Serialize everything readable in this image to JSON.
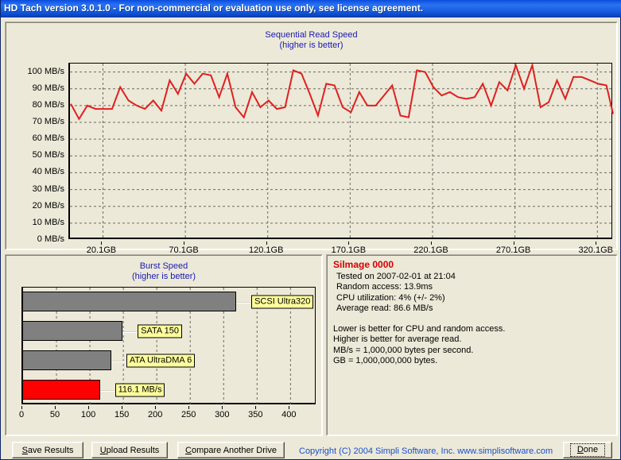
{
  "window": {
    "title": "HD Tach version 3.0.1.0  - For non-commercial or evaluation use only, see license agreement.",
    "titlebar_color": "#0a4ad8"
  },
  "sequential": {
    "title": "Sequential Read Speed",
    "subtitle": "(higher is better)"
  },
  "burst": {
    "title": "Burst Speed",
    "subtitle": "(higher is better)"
  },
  "info": {
    "drive": "Silmage 0000",
    "tested": "Tested on 2007-02-01 at 21:04",
    "random_access": "Random access: 13.9ms",
    "cpu_utilization": "CPU utilization: 4% (+/- 2%)",
    "average_read": "Average read: 86.6 MB/s",
    "note1": "Lower is better for CPU and random access.",
    "note2": "Higher is better for average read.",
    "note3": "MB/s = 1,000,000 bytes per second.",
    "note4": "GB = 1,000,000,000 bytes."
  },
  "buttons": {
    "save": "Save Results",
    "save_accel": "S",
    "save_rest": "ave Results",
    "upload": "Upload Results",
    "upload_accel": "U",
    "upload_rest": "pload Results",
    "compare": "Compare Another Drive",
    "compare_accel": "C",
    "compare_rest": "ompare Another Drive",
    "done": "Done",
    "done_accel": "D",
    "done_rest": "one",
    "copyright": "Copyright (C) 2004 Simpli Software, Inc. www.simplisoftware.com"
  },
  "chart_data": [
    {
      "type": "line",
      "title": "Sequential Read Speed",
      "subtitle": "(higher is better)",
      "xlabel": "",
      "ylabel": "MB/s",
      "xlim": [
        0.1,
        330.1
      ],
      "ylim": [
        0,
        105
      ],
      "grid": true,
      "line_color": "#e02020",
      "ytick_labels": [
        "100 MB/s",
        "90 MB/s",
        "80 MB/s",
        "70 MB/s",
        "60 MB/s",
        "50 MB/s",
        "40 MB/s",
        "30 MB/s",
        "20 MB/s",
        "10 MB/s",
        "0 MB/s"
      ],
      "yticks": [
        100,
        90,
        80,
        70,
        60,
        50,
        40,
        30,
        20,
        10,
        0
      ],
      "xtick_labels": [
        "20.1GB",
        "70.1GB",
        "120.1GB",
        "170.1GB",
        "220.1GB",
        "270.1GB",
        "320.1GB"
      ],
      "xticks": [
        20.1,
        70.1,
        120.1,
        170.1,
        220.1,
        270.1,
        320.1
      ],
      "x": [
        0.6,
        5.6,
        10.6,
        15.6,
        20.6,
        25.6,
        30.6,
        35.6,
        40.6,
        45.6,
        50.6,
        55.6,
        60.6,
        65.6,
        70.6,
        75.6,
        80.6,
        85.6,
        90.6,
        95.6,
        100.6,
        105.6,
        110.6,
        115.6,
        120.6,
        125.6,
        130.6,
        135.6,
        140.6,
        145.6,
        150.6,
        155.6,
        160.6,
        165.6,
        170.6,
        175.6,
        180.6,
        185.6,
        190.6,
        195.6,
        200.6,
        205.6,
        210.6,
        215.6,
        220.6,
        225.6,
        230.6,
        235.6,
        240.6,
        245.6,
        250.6,
        255.6,
        260.6,
        265.6,
        270.6,
        275.6,
        280.6,
        285.6,
        290.6,
        295.6,
        300.6,
        305.6,
        310.6,
        315.6,
        320.6,
        325.6,
        329.6
      ],
      "y": [
        81,
        72,
        80,
        78,
        78,
        78,
        91,
        83,
        80,
        78,
        83,
        77,
        95,
        87,
        99,
        93,
        99,
        98,
        85,
        99,
        79,
        73,
        88,
        79,
        83,
        78,
        79,
        101,
        99,
        87,
        74,
        93,
        92,
        79,
        76,
        88,
        80,
        80,
        86,
        92,
        74,
        73,
        101,
        100,
        91,
        86,
        88,
        85,
        84,
        85,
        93,
        80,
        94,
        89,
        104,
        90,
        104,
        79,
        82,
        95,
        84,
        97,
        97,
        95,
        93,
        92,
        75
      ],
      "series": [
        {
          "name": "Read speed",
          "color": "#e02020"
        }
      ]
    },
    {
      "type": "bar",
      "orientation": "horizontal",
      "title": "Burst Speed",
      "subtitle": "(higher is better)",
      "xlabel": "",
      "ylabel": "",
      "xlim": [
        0,
        440
      ],
      "grid": true,
      "xticks": [
        0,
        50,
        100,
        150,
        200,
        250,
        300,
        350,
        400
      ],
      "xtick_labels": [
        "0",
        "50",
        "100",
        "150",
        "200",
        "250",
        "300",
        "350",
        "400"
      ],
      "categories": [
        "SCSI Ultra320",
        "SATA 150",
        "ATA UltraDMA 6",
        "116.1 MB/s"
      ],
      "values": [
        320,
        150,
        133,
        116.1
      ],
      "colors": [
        "#808080",
        "#808080",
        "#808080",
        "#ff0000"
      ],
      "labels": [
        "SCSI Ultra320",
        "SATA 150",
        "ATA UltraDMA 6",
        "116.1 MB/s"
      ]
    }
  ]
}
